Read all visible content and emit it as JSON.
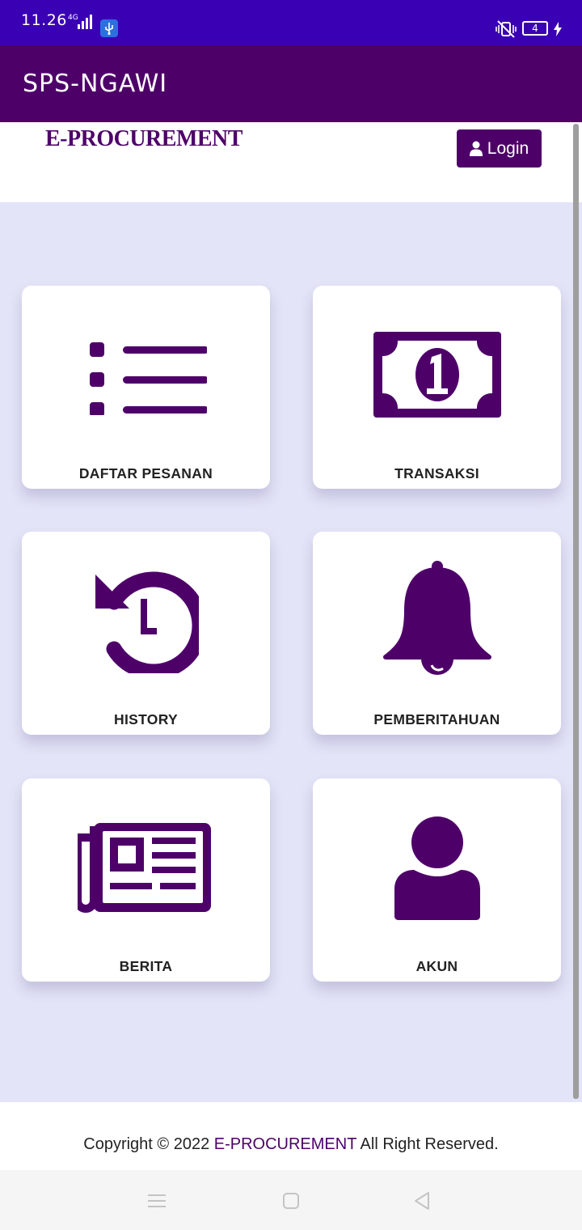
{
  "status_bar": {
    "time": "11.26",
    "network": "4G",
    "battery_level": "4"
  },
  "app_bar": {
    "title": "SPS-NGAWI"
  },
  "header": {
    "logo": "E-PROCUREMENT",
    "login_label": "Login"
  },
  "menu": {
    "items": [
      {
        "label": "DAFTAR PESANAN",
        "icon": "list-icon"
      },
      {
        "label": "TRANSAKSI",
        "icon": "money-bill-icon"
      },
      {
        "label": "HISTORY",
        "icon": "history-icon"
      },
      {
        "label": "PEMBERITAHUAN",
        "icon": "bell-icon"
      },
      {
        "label": "BERITA",
        "icon": "newspaper-icon"
      },
      {
        "label": "AKUN",
        "icon": "user-icon"
      }
    ]
  },
  "footer": {
    "prefix": "Copyright © 2022 ",
    "brand": "E-PROCUREMENT",
    "suffix": " All Right Reserved."
  },
  "colors": {
    "status_bar": "#3a00b4",
    "primary": "#4e0069",
    "content_bg": "#e3e4f7"
  }
}
